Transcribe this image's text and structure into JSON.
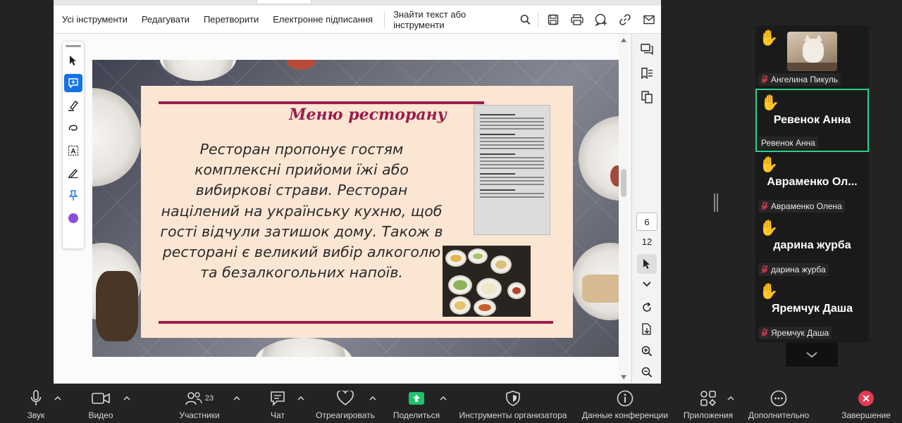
{
  "acrobat": {
    "menu": [
      "Усі інструменти",
      "Редагувати",
      "Перетворити",
      "Електронне підписання"
    ],
    "search_label": "Знайти текст або інструменти",
    "page_current": "6",
    "page_total": "12"
  },
  "slide": {
    "title": "Меню ресторану",
    "text": "Ресторан пропонує гостям комплексні прийоми їжі або вибиркові страви. Ресторан націлений на українську кухню, щоб гості відчули затишок дому. Також в ресторані є великий вибір алкоголю та безалкогольних напоїв."
  },
  "participants": [
    {
      "label": "Ангелина Пикуль",
      "big_name": "",
      "has_video": true,
      "active": false
    },
    {
      "label": "Ревенок Анна",
      "big_name": "Ревенок Анна",
      "has_video": false,
      "active": true
    },
    {
      "label": "Авраменко Олена",
      "big_name": "Авраменко  Ол...",
      "has_video": false,
      "active": false
    },
    {
      "label": "дарина журба",
      "big_name": "дарина журба",
      "has_video": false,
      "active": false
    },
    {
      "label": "Яремчук Даша",
      "big_name": "Яремчук Даша",
      "has_video": false,
      "active": false
    }
  ],
  "toolbar": {
    "audio": "Звук",
    "video": "Видео",
    "participants": "Участники",
    "participants_count": "23",
    "chat": "Чат",
    "react": "Отреагировать",
    "share": "Поделиться",
    "host_tools": "Инструменты организатора",
    "meeting_info": "Данные конференции",
    "apps": "Приложения",
    "more": "Дополнительно",
    "end": "Завершение"
  },
  "colors": {
    "slide_accent": "#9b1d4d",
    "active_speaker": "#2bd18a",
    "share_green": "#1fc26b",
    "end_red": "#e5394f",
    "acrobat_blue": "#1473e6"
  }
}
